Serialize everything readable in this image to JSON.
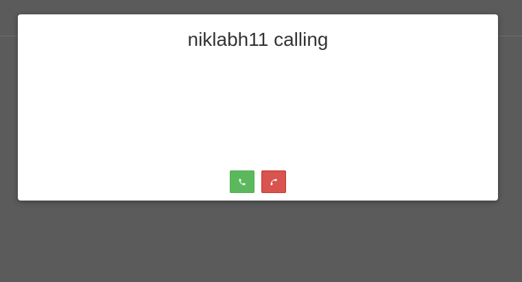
{
  "modal": {
    "title": "niklabh11 calling"
  },
  "actions": {
    "accept_icon": "phone-icon",
    "decline_icon": "phone-hangup-icon"
  },
  "colors": {
    "overlay": "#5b5b5b",
    "accept": "#5cb85c",
    "decline": "#d9534f"
  }
}
